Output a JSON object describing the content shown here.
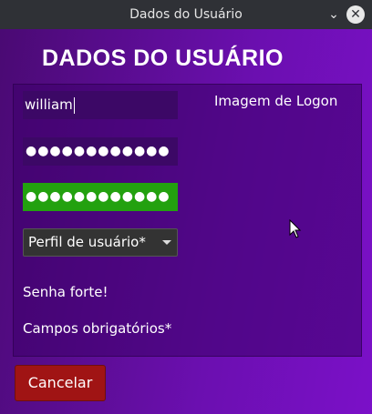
{
  "window": {
    "title": "Dados do Usuário",
    "minimize_glyph": "⌄",
    "close_glyph": "✕"
  },
  "form": {
    "heading": "DADOS DO USUÁRIO",
    "username_value": "william",
    "password_masked": "●●●●●●●●●●●●",
    "confirm_masked": "●●●●●●●●●●●●",
    "profile_selected": "Perfil de usuário*",
    "logon_image_label": "Imagem de Logon",
    "strength_text": "Senha forte!",
    "required_note": "Campos obrigatórios*",
    "cancel_label": "Cancelar"
  },
  "colors": {
    "confirm_ok": "#23a10f",
    "cancel_button": "#a01414",
    "window_bg": "#6b0fb0"
  },
  "icons": {
    "minimize": "chevron-down-icon",
    "close": "close-icon",
    "pointer": "mouse-pointer-icon"
  }
}
